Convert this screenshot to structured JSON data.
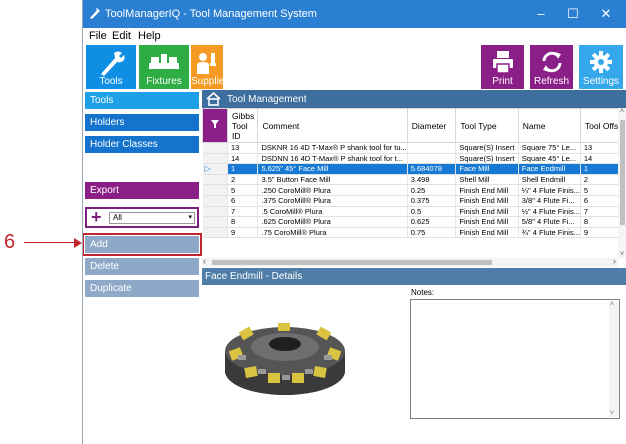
{
  "callout": {
    "number": "6"
  },
  "window": {
    "title": "ToolManagerIQ - Tool Management System",
    "controls": {
      "minimize": "–",
      "maximize": "☐",
      "close": "✕"
    }
  },
  "menu": [
    "File",
    "Edit",
    "Help"
  ],
  "toolbar": {
    "tools": "Tools",
    "fixtures": "Fixtures",
    "suppliers": "Suppliers",
    "print": "Print",
    "refresh": "Refresh",
    "settings": "Settings",
    "colors": {
      "blue": "#0e8fe4",
      "green": "#2fad45",
      "orange": "#f59a22",
      "purple": "#8a1f88",
      "light_blue": "#34a8ea"
    }
  },
  "sidebar": {
    "nav": [
      "Tools",
      "Holders",
      "Holder Classes"
    ],
    "export": "Export",
    "filter_value": "All",
    "actions": [
      "Add",
      "Delete",
      "Duplicate"
    ]
  },
  "tool_management": {
    "title": "Tool Management",
    "columns": [
      "Gibbs Tool ID",
      "Comment",
      "Diameter",
      "Tool Type",
      "Name",
      "Tool Offset"
    ],
    "rows": [
      [
        "13",
        "DSKNR 16 4D T-Max® P shank tool for tu...",
        "",
        "Square(S) Insert",
        "Square 75° Le...",
        "13"
      ],
      [
        "14",
        "DSDNN 16 4D T-Max® P shank tool for t...",
        "",
        "Square(S) Insert",
        "Square 45° Le...",
        "14"
      ],
      [
        "1",
        "5.625\" 45° Face Mill",
        "5.684078",
        "Face Mill",
        "Face Endmill",
        "1"
      ],
      [
        "2",
        "3.5\" Button Face Mill",
        "3.498",
        "Shell Mill",
        "Shell Endmill",
        "2"
      ],
      [
        "5",
        ".250 CoroMill® Plura",
        "0.25",
        "Finish End Mill",
        "¼\" 4 Flute Finis...",
        "5"
      ],
      [
        "6",
        ".375 CoroMill® Plura",
        "0.375",
        "Finish End Mill",
        "3/8\" 4 Flute Fi...",
        "6"
      ],
      [
        "7",
        ".5 CoroMill® Plura",
        "0.5",
        "Finish End Mill",
        "½\" 4 Flute Finis...",
        "7"
      ],
      [
        "8",
        ".625 CoroMill® Plura",
        "0.625",
        "Finish End Mill",
        "5/8\" 4 Flute Fi...",
        "8"
      ],
      [
        "9",
        ".75 CoroMill® Plura",
        "0.75",
        "Finish End Mill",
        "¾\" 4 Flute Finis...",
        "9"
      ]
    ],
    "selected_row_index": 2,
    "selected_marker": "▷"
  },
  "details": {
    "title": "Face Endmill - Details",
    "notes_label": "Notes:"
  }
}
